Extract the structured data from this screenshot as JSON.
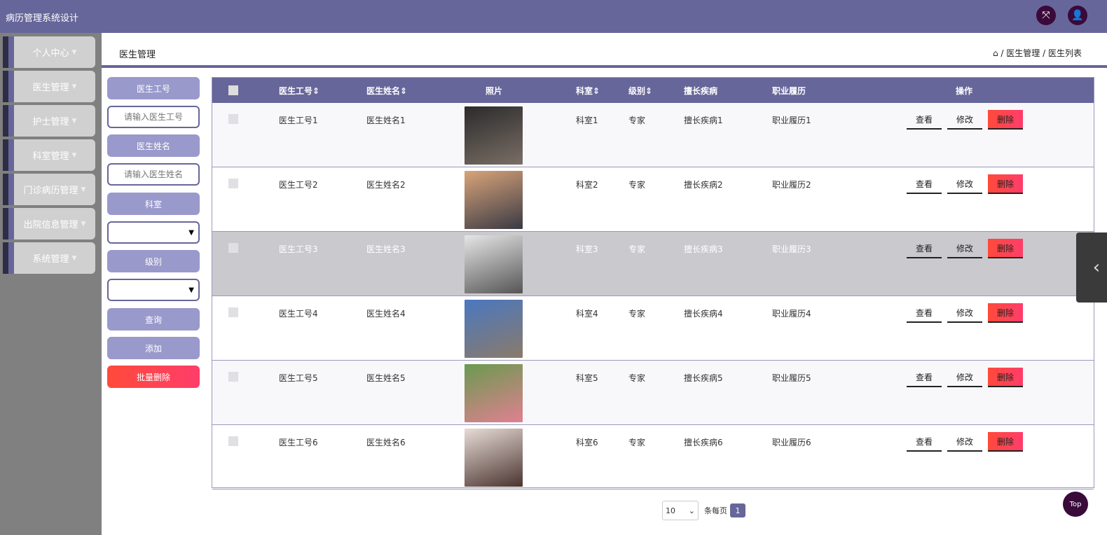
{
  "app": {
    "title": "病历管理系统设计"
  },
  "sidebar": {
    "items": [
      {
        "label": "个人中心"
      },
      {
        "label": "医生管理"
      },
      {
        "label": "护士管理"
      },
      {
        "label": "科室管理"
      },
      {
        "label": "门诊病历管理"
      },
      {
        "label": "出院信息管理"
      },
      {
        "label": "系统管理"
      }
    ]
  },
  "page": {
    "title": "医生管理",
    "breadcrumb": [
      "医生管理",
      "医生列表"
    ],
    "sep": "/"
  },
  "filters": {
    "id_label": "医生工号",
    "id_placeholder": "请输入医生工号",
    "name_label": "医生姓名",
    "name_placeholder": "请输入医生姓名",
    "dept_label": "科室",
    "level_label": "级别",
    "query": "查询",
    "add": "添加",
    "batch_delete": "批量删除"
  },
  "table": {
    "headers": [
      "医生工号",
      "医生姓名",
      "照片",
      "科室",
      "级别",
      "擅长疾病",
      "职业履历",
      "操作"
    ],
    "rows": [
      {
        "id": "医生工号1",
        "name": "医生姓名1",
        "dept": "科室1",
        "level": "专家",
        "spec": "擅长疾病1",
        "career": "职业履历1"
      },
      {
        "id": "医生工号2",
        "name": "医生姓名2",
        "dept": "科室2",
        "level": "专家",
        "spec": "擅长疾病2",
        "career": "职业履历2"
      },
      {
        "id": "医生工号3",
        "name": "医生姓名3",
        "dept": "科室3",
        "level": "专家",
        "spec": "擅长疾病3",
        "career": "职业履历3"
      },
      {
        "id": "医生工号4",
        "name": "医生姓名4",
        "dept": "科室4",
        "level": "专家",
        "spec": "擅长疾病4",
        "career": "职业履历4"
      },
      {
        "id": "医生工号5",
        "name": "医生姓名5",
        "dept": "科室5",
        "level": "专家",
        "spec": "擅长疾病5",
        "career": "职业履历5"
      },
      {
        "id": "医生工号6",
        "name": "医生姓名6",
        "dept": "科室6",
        "level": "专家",
        "spec": "擅长疾病6",
        "career": "职业履历6"
      }
    ],
    "actions": {
      "view": "查看",
      "edit": "修改",
      "delete": "删除"
    }
  },
  "pagination": {
    "page_size": "10",
    "per_page_label": "条每页",
    "current": "1"
  },
  "top_button": "Top"
}
